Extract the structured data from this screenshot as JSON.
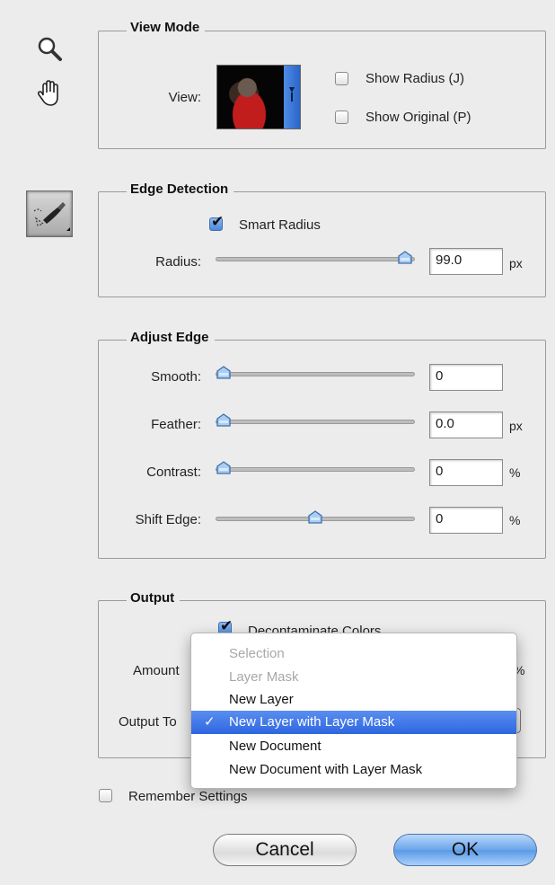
{
  "tools": {
    "zoom_icon": "magnifier-icon",
    "hand_icon": "hand-icon",
    "refine_brush_icon": "refine-radius-brush-icon"
  },
  "view_mode": {
    "title": "View Mode",
    "view_label": "View:",
    "show_radius": {
      "label": "Show Radius (J)",
      "checked": false
    },
    "show_original": {
      "label": "Show Original (P)",
      "checked": false
    }
  },
  "edge_detection": {
    "title": "Edge Detection",
    "smart_radius": {
      "label": "Smart Radius",
      "checked": true
    },
    "radius": {
      "label": "Radius:",
      "value": "99.0",
      "unit": "px",
      "slider_fraction": 0.99
    }
  },
  "adjust_edge": {
    "title": "Adjust Edge",
    "rows": [
      {
        "label": "Smooth:",
        "value": "0",
        "unit": "",
        "slider_fraction": 0.0
      },
      {
        "label": "Feather:",
        "value": "0.0",
        "unit": "px",
        "slider_fraction": 0.0
      },
      {
        "label": "Contrast:",
        "value": "0",
        "unit": "%",
        "slider_fraction": 0.0
      },
      {
        "label": "Shift Edge:",
        "value": "0",
        "unit": "%",
        "slider_fraction": 0.5
      }
    ]
  },
  "output": {
    "title": "Output",
    "decontaminate": {
      "label": "Decontaminate Colors",
      "checked": true
    },
    "amount_label": "Amount",
    "amount_unit": "%",
    "output_to_label": "Output To"
  },
  "output_menu": {
    "items": [
      {
        "label": "Selection",
        "disabled": true,
        "selected": false
      },
      {
        "label": "Layer Mask",
        "disabled": true,
        "selected": false
      },
      {
        "label": "New Layer",
        "disabled": false,
        "selected": false
      },
      {
        "label": "New Layer with Layer Mask",
        "disabled": false,
        "selected": true
      },
      {
        "label": "New Document",
        "disabled": false,
        "selected": false
      },
      {
        "label": "New Document with Layer Mask",
        "disabled": false,
        "selected": false
      }
    ],
    "check_mark": "✓"
  },
  "remember_settings": {
    "label": "Remember Settings",
    "checked": false
  },
  "buttons": {
    "cancel": "Cancel",
    "ok": "OK"
  },
  "colors": {
    "accent": "#2e66e0",
    "ok_button": "#6aa5ea"
  }
}
